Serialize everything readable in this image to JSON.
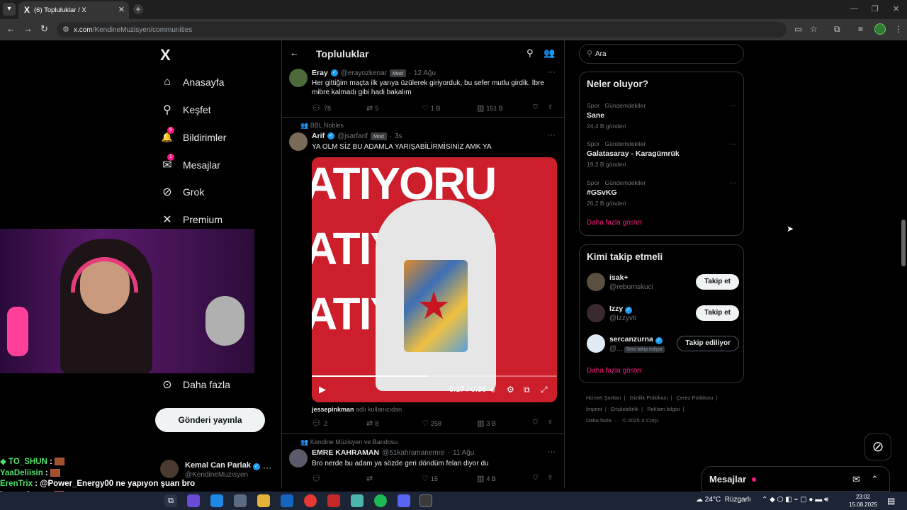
{
  "browser": {
    "tab_title": "(6) Topluluklar / X",
    "url_host": "x.com",
    "url_path": "/KendineMuzisyen/communities",
    "tab_favicon": "X"
  },
  "left_nav": {
    "logo": "X",
    "items": [
      {
        "label": "Anasayfa",
        "icon": "home-icon",
        "glyph": "⌂"
      },
      {
        "label": "Keşfet",
        "icon": "search-icon",
        "glyph": "⚲"
      },
      {
        "label": "Bildirimler",
        "icon": "bell-icon",
        "glyph": "🔔",
        "badge": "5"
      },
      {
        "label": "Mesajlar",
        "icon": "mail-icon",
        "glyph": "✉",
        "badge": "1"
      },
      {
        "label": "Grok",
        "icon": "grok-icon",
        "glyph": "⊘"
      },
      {
        "label": "Premium",
        "icon": "x-icon",
        "glyph": "✕"
      }
    ],
    "more_label": "Daha fazla",
    "post_button": "Gönderi yayınla",
    "account": {
      "name": "Kemal Can Parlak",
      "handle": "@KendineMuzisyen"
    }
  },
  "main": {
    "title": "Topluluklar",
    "posts": [
      {
        "name": "Eray",
        "handle": "@erayozkenar",
        "badge": "Mod",
        "time": "12 Ağu",
        "text": "Her gittiğim maçta ilk yarıya üzülerek giriyorduk, bu sefer mutlu girdik. İbre mibre kalmadı gibi hadi bakalım",
        "replies": "78",
        "reposts": "5",
        "likes": "1 B",
        "views": "151 B"
      },
      {
        "context": "BBL Nobles",
        "name": "Arif",
        "handle": "@jsarfarif",
        "badge": "Mod",
        "time": "3s",
        "text": "YA OLM SİZ BU ADAMLA YARIŞABİLİRMİSİNİZ AMK YA",
        "media_text": "ATIYORU",
        "video_time": "0:17 / 0:36",
        "video_progress": 0.47,
        "caption_user": "jessepinkman",
        "caption_rest": "adlı kullanıcıdan",
        "replies": "2",
        "reposts": "8",
        "likes": "258",
        "views": "3 B"
      },
      {
        "context": "Kendine Müzisyen ve Bandosu",
        "name": "EMRE KAHRAMAN",
        "handle": "@51kahramanemre",
        "time": "11 Ağu",
        "text": "Bro nerde bu adam ya sözde geri döndüm felan diyor du",
        "replies": "",
        "reposts": "",
        "likes": "15",
        "views": "4 B"
      }
    ]
  },
  "right": {
    "search_placeholder": "Ara",
    "trends_title": "Neler oluyor?",
    "trends": [
      {
        "category": "Spor · Gündemdekiler",
        "name": "Sane",
        "count": "24,4 B gönderi"
      },
      {
        "category": "Spor · Gündemdekiler",
        "name": "Galatasaray - Karagümrük",
        "count": "19,2 B gönderi"
      },
      {
        "category": "Spor · Gündemdekiler",
        "name": "#GSvKG",
        "count": "26,2 B gönderi"
      }
    ],
    "show_more": "Daha fazla göster",
    "follow_title": "Kimi takip etmeli",
    "follow": [
      {
        "name": "isak+",
        "handle": "@rebornskuci",
        "button": "Takip et",
        "verified": false
      },
      {
        "name": "Izzy",
        "handle": "@Izzyvlr",
        "button": "Takip et",
        "verified": true
      },
      {
        "name": "sercanzurna",
        "handle": "@...",
        "follows_you": "Seni takip ediyor",
        "button": "Takip ediliyor",
        "verified": true
      }
    ],
    "footer": [
      "Hizmet Şartları",
      "|",
      "Gizlilik Politikası",
      "|",
      "Çerez Politikası",
      "|",
      "Imprint",
      "|",
      "Erişilebilirlik",
      "|",
      "Reklam bilgisi",
      "|",
      "Daha fazla ···",
      "© 2025 X Corp."
    ]
  },
  "messages_drawer": {
    "title": "Mesajlar"
  },
  "chat": [
    {
      "user": "TO_SHUN",
      "color": "#4fe06a",
      "msg": ""
    },
    {
      "user": "YaaDeliisin",
      "color": "#4fe06a",
      "msg": ""
    },
    {
      "user": "ErenTrix",
      "color": "#4fe06a",
      "msg": "@Power_Energy00 ne yapıyon şuan bro"
    },
    {
      "user": "burnsahmet",
      "color": "#ffffff",
      "msg": ""
    }
  ],
  "taskbar": {
    "weather": "24°C",
    "weather_label": "Rüzgarlı",
    "time": "23:02",
    "date": "15.08.2025"
  },
  "colors": {
    "accent": "#f91880",
    "verified": "#1d9bf0",
    "border": "#2f3336",
    "muted": "#71767b"
  }
}
